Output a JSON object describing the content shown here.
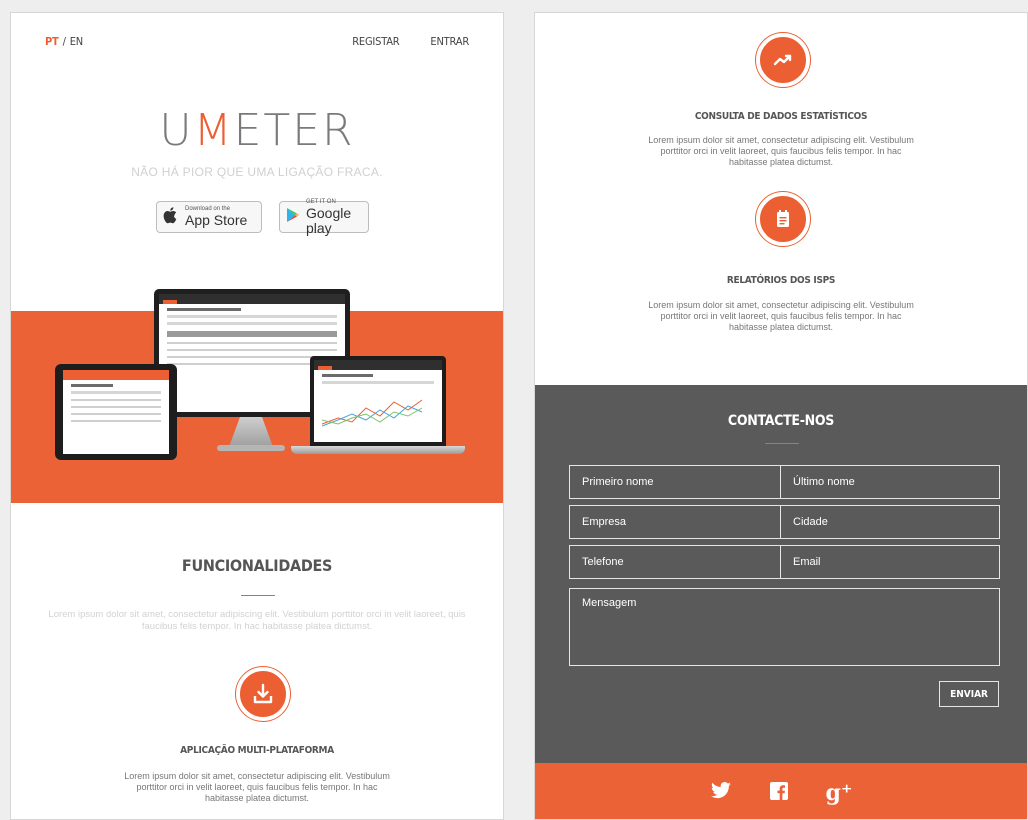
{
  "header": {
    "lang_active": "PT",
    "lang_sep": "/",
    "lang_other": "EN",
    "register": "REGISTAR",
    "login": "ENTRAR"
  },
  "hero": {
    "brand_prefix": "U",
    "brand_accent": "M",
    "brand_suffix": "ETER",
    "tagline": "NÃO HÁ PIOR QUE UMA LIGAÇÃO FRACA.",
    "appstore_small": "Download on the",
    "appstore_big": "App Store",
    "googleplay_small": "GET IT ON",
    "googleplay_big": "Google play"
  },
  "features": {
    "title": "FUNCIONALIDADES",
    "intro": "Lorem ipsum dolor sit amet, consectetur adipiscing elit. Vestibulum porttitor orci in velit laoreet, quis faucibus felis tempor. In hac habitasse platea dictumst.",
    "items": [
      {
        "title": "APLICAÇÃO MULTI-PLATAFORMA",
        "icon": "download-icon",
        "text": "Lorem ipsum dolor sit amet, consectetur adipiscing elit. Vestibulum porttitor orci in velit laoreet, quis faucibus felis tempor. In hac habitasse platea dictumst."
      },
      {
        "title": "CONSULTA DE DADOS ESTATÍSTICOS",
        "icon": "trending-up-icon",
        "text": "Lorem ipsum dolor sit amet, consectetur adipiscing elit. Vestibulum porttitor orci in velit laoreet, quis faucibus felis tempor. In hac habitasse platea dictumst."
      },
      {
        "title": "RELATÓRIOS DOS ISPS",
        "icon": "notepad-icon",
        "text": "Lorem ipsum dolor sit amet, consectetur adipiscing elit. Vestibulum porttitor orci in velit laoreet, quis faucibus felis tempor. In hac habitasse platea dictumst."
      }
    ]
  },
  "contact": {
    "title": "CONTACTE-NOS",
    "first_name": "Primeiro nome",
    "last_name": "Último nome",
    "company": "Empresa",
    "city": "Cidade",
    "phone": "Telefone",
    "email": "Email",
    "message": "Mensagem",
    "send": "ENVIAR"
  },
  "footer": {
    "social": [
      "twitter-icon",
      "facebook-icon",
      "google-plus-icon"
    ],
    "facebook_glyph": "f",
    "gplus_glyph": "g⁺"
  },
  "colors": {
    "accent": "#ec6237",
    "dark_section": "#5a5a5a"
  }
}
